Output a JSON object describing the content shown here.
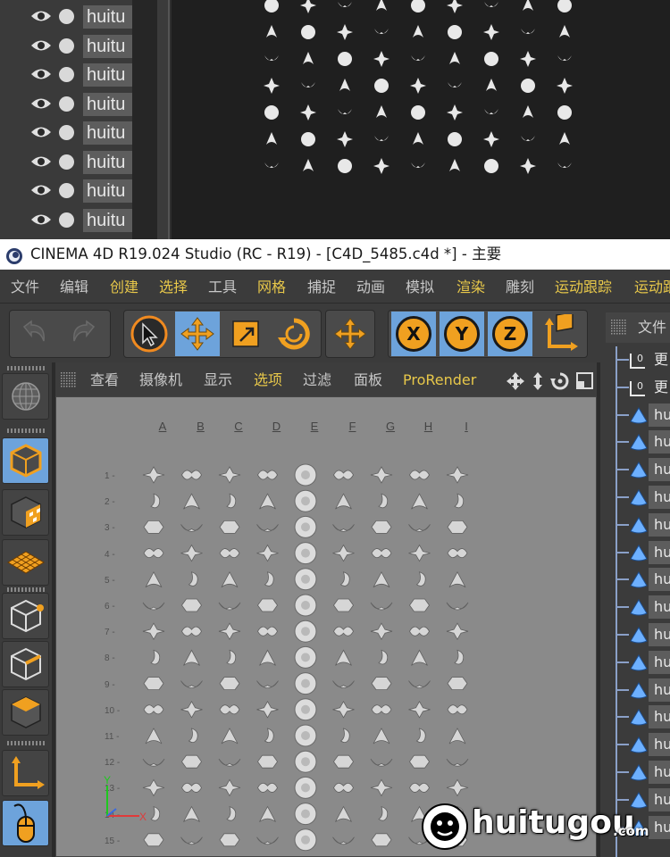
{
  "top_panel": {
    "row_label": "huitu",
    "row_count": 8
  },
  "titlebar": {
    "title": "CINEMA 4D R19.024 Studio (RC - R19) - [C4D_5485.c4d *] - 主要"
  },
  "menubar": {
    "items": [
      {
        "label": "文件",
        "color": "#c8c8c8"
      },
      {
        "label": "编辑",
        "color": "#c8c8c8"
      },
      {
        "label": "创建",
        "color": "#e8c84a"
      },
      {
        "label": "选择",
        "color": "#e8c84a"
      },
      {
        "label": "工具",
        "color": "#c8c8c8"
      },
      {
        "label": "网格",
        "color": "#e8c84a"
      },
      {
        "label": "捕捉",
        "color": "#c8c8c8"
      },
      {
        "label": "动画",
        "color": "#c8c8c8"
      },
      {
        "label": "模拟",
        "color": "#c8c8c8"
      },
      {
        "label": "渲染",
        "color": "#e8c84a"
      },
      {
        "label": "雕刻",
        "color": "#c8c8c8"
      },
      {
        "label": "运动跟踪",
        "color": "#e8c84a"
      },
      {
        "label": "运动跟",
        "color": "#e8c84a"
      }
    ]
  },
  "toolbar": {
    "undo_icon": "undo-icon",
    "redo_icon": "redo-icon",
    "axis": [
      "X",
      "Y",
      "Z"
    ]
  },
  "viewport": {
    "menu": [
      {
        "label": "查看",
        "color": "#c8c8c8"
      },
      {
        "label": "摄像机",
        "color": "#c8c8c8"
      },
      {
        "label": "显示",
        "color": "#c8c8c8"
      },
      {
        "label": "选项",
        "color": "#e8c84a"
      },
      {
        "label": "过滤",
        "color": "#c8c8c8"
      },
      {
        "label": "面板",
        "color": "#c8c8c8"
      },
      {
        "label": "ProRender",
        "color": "#e8c84a"
      }
    ],
    "columns": [
      "A",
      "B",
      "C",
      "D",
      "E",
      "F",
      "G",
      "H",
      "I"
    ],
    "rows": [
      "1 -",
      "2 -",
      "3 -",
      "4 -",
      "5 -",
      "6 -",
      "7 -",
      "8 -",
      "9 -",
      "10 -",
      "11 -",
      "12 -",
      "13 -",
      "14 -",
      "15 -"
    ]
  },
  "object_manager": {
    "header": "文件",
    "items": [
      {
        "label": "更",
        "type": "layer"
      },
      {
        "label": "更",
        "type": "layer"
      },
      {
        "label": "hu",
        "type": "object"
      },
      {
        "label": "hu",
        "type": "object"
      },
      {
        "label": "hu",
        "type": "object"
      },
      {
        "label": "hu",
        "type": "object"
      },
      {
        "label": "hu",
        "type": "object"
      },
      {
        "label": "hu",
        "type": "object"
      },
      {
        "label": "hu",
        "type": "object"
      },
      {
        "label": "hu",
        "type": "object"
      },
      {
        "label": "hu",
        "type": "object"
      },
      {
        "label": "hu",
        "type": "object"
      },
      {
        "label": "hu",
        "type": "object"
      },
      {
        "label": "hu",
        "type": "object"
      },
      {
        "label": "hu",
        "type": "object"
      },
      {
        "label": "hu",
        "type": "object"
      },
      {
        "label": "hu",
        "type": "object"
      },
      {
        "label": "hu",
        "type": "object"
      }
    ]
  },
  "watermark": {
    "text": "huitugou",
    "domain": ".com"
  },
  "colors": {
    "accent_blue": "#6da3db",
    "accent_orange": "#f0a020",
    "highlight_text": "#e8c84a"
  }
}
